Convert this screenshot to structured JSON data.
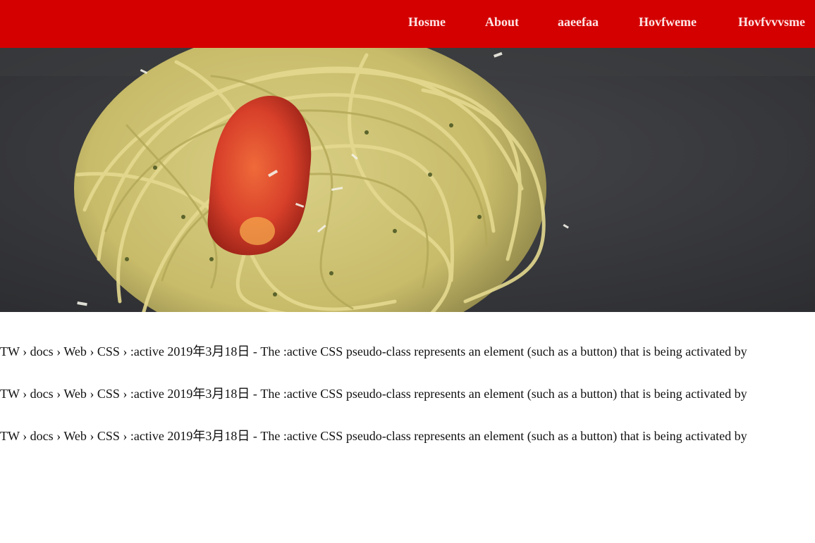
{
  "nav": {
    "items": [
      {
        "label": "Hosme"
      },
      {
        "label": "About"
      },
      {
        "label": "aaeefaa"
      },
      {
        "label": "Hovfweme"
      },
      {
        "label": "Hovfvvvsme"
      }
    ],
    "background": "#d40000",
    "text_color": "#ffe6e6"
  },
  "hero": {
    "subject": "pesto spaghetti with roasted tomato",
    "background": "#38393c"
  },
  "results": [
    {
      "text": "TW › docs › Web › CSS › :active 2019年3月18日 - The :active CSS pseudo-class represents an element (such as a button) that is being activated by"
    },
    {
      "text": "TW › docs › Web › CSS › :active 2019年3月18日 - The :active CSS pseudo-class represents an element (such as a button) that is being activated by"
    },
    {
      "text": "TW › docs › Web › CSS › :active 2019年3月18日 - The :active CSS pseudo-class represents an element (such as a button) that is being activated by"
    }
  ]
}
